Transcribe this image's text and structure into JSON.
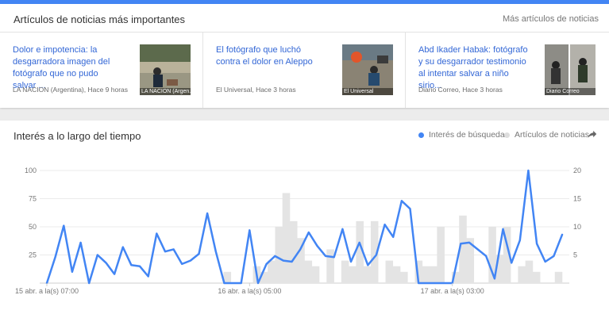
{
  "colors": {
    "accent": "#4285f4",
    "link": "#3367d6",
    "bars": "#e4e4e4",
    "text_muted": "#777777"
  },
  "news": {
    "title": "Artículos de noticias más importantes",
    "more_link": "Más artículos de noticias",
    "articles": [
      {
        "title": "Dolor e impotencia: la desgarradora imagen del fotógrafo que no pudo salvar ...",
        "source": "LA NACION (Argentina), Hace 9 horas",
        "thumb_caption": "LA NACION (Argen..."
      },
      {
        "title": "El fotógrafo que luchó contra el dolor en Aleppo",
        "source": "El Universal, Hace 3 horas",
        "thumb_caption": "El Universal"
      },
      {
        "title": "Abd Ikader Habak: fotógrafo y su desgarrador testimonio al intentar salvar a niño sirio...",
        "source": "Diario Correo, Hace 3 horas",
        "thumb_caption": "Diario Correo"
      }
    ]
  },
  "interest": {
    "title": "Interés a lo largo del tiempo",
    "legend": [
      {
        "label": "Interés de búsqueda",
        "color": "#4285f4"
      },
      {
        "label": "Artículos de noticias",
        "color": "#dddddd"
      }
    ],
    "share_icon": "share-arrow-icon"
  },
  "chart_data": {
    "type": "line",
    "x_tick_labels": [
      "15 abr. a la(s) 07:00",
      "16 abr. a la(s) 05:00",
      "17 abr. a la(s) 03:00"
    ],
    "x_tick_index": [
      0,
      24,
      48
    ],
    "left_axis": {
      "ticks": [
        "100",
        "75",
        "50",
        "25"
      ],
      "ylim": [
        0,
        100
      ]
    },
    "right_axis": {
      "ticks": [
        "20",
        "15",
        "10",
        "5"
      ],
      "ylim": [
        0,
        20
      ]
    },
    "grid": true,
    "series": [
      {
        "name": "Interés de búsqueda",
        "axis": "left",
        "values": [
          0,
          23,
          51,
          10,
          36,
          0,
          25,
          18,
          8,
          32,
          16,
          15,
          6,
          44,
          28,
          30,
          17,
          20,
          26,
          62,
          28,
          0,
          0,
          0,
          47,
          0,
          17,
          24,
          20,
          19,
          30,
          45,
          33,
          24,
          23,
          48,
          19,
          36,
          16,
          25,
          52,
          41,
          73,
          66,
          0,
          0,
          0,
          0,
          0,
          35,
          36,
          30,
          24,
          4,
          48,
          18,
          38,
          100,
          35,
          19,
          24,
          43
        ]
      },
      {
        "name": "Artículos de noticias",
        "axis": "right",
        "type": "bar",
        "values": [
          0,
          0,
          0,
          0,
          0,
          0,
          0,
          0,
          0,
          0,
          0,
          0,
          0,
          0,
          0,
          0,
          0,
          0,
          0,
          0,
          0,
          0,
          0,
          0,
          2,
          0,
          0,
          0,
          3,
          2,
          4,
          10,
          16,
          11,
          8,
          4,
          3,
          0,
          6,
          0,
          4,
          3,
          11,
          3,
          11,
          0,
          4,
          3,
          2,
          0,
          4,
          3,
          3,
          10,
          0,
          2,
          12,
          8,
          0,
          0,
          10,
          5,
          10,
          0,
          3,
          4,
          2,
          0,
          0,
          2
        ]
      }
    ]
  }
}
